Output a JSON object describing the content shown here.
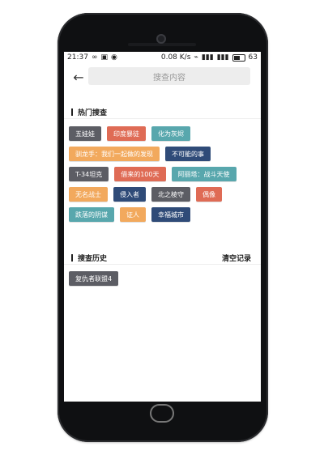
{
  "status": {
    "time": "21:37",
    "network": "0.08",
    "network_unit": "K/s",
    "battery": "63"
  },
  "search": {
    "placeholder": "搜查内容"
  },
  "sections": {
    "hot_title": "热门搜查",
    "history_title": "搜查历史",
    "clear_label": "清空记录"
  },
  "hot_tags": [
    {
      "label": "五娃娃",
      "color": "#5c5d64"
    },
    {
      "label": "印度暴徒",
      "color": "#df6b55"
    },
    {
      "label": "化为灰烬",
      "color": "#58a7ad"
    },
    {
      "label": "驯龙手：我们一起做的发现",
      "color": "#f2a95d"
    },
    {
      "label": "不可能的事",
      "color": "#2f4b78"
    },
    {
      "label": "T-34坦克",
      "color": "#5c5d64"
    },
    {
      "label": "借来的100天",
      "color": "#df6b55"
    },
    {
      "label": "阿丽塔：战斗天使",
      "color": "#58a7ad"
    },
    {
      "label": "无名战士",
      "color": "#f2a95d"
    },
    {
      "label": "侵入者",
      "color": "#2f4b78"
    },
    {
      "label": "北之棱守",
      "color": "#5c5d64"
    },
    {
      "label": "偶像",
      "color": "#df6b55"
    },
    {
      "label": "跌落的阴谋",
      "color": "#58a7ad"
    },
    {
      "label": "证人",
      "color": "#f2a95d"
    },
    {
      "label": "幸福城市",
      "color": "#2f4b78"
    }
  ],
  "history_tags": [
    {
      "label": "复仇者联盟4"
    }
  ]
}
